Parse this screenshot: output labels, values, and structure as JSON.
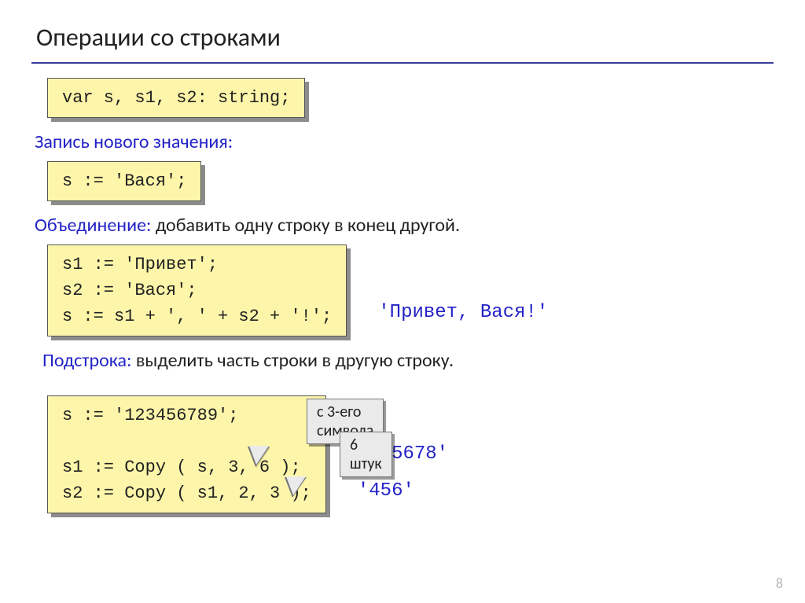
{
  "title": "Операции со строками",
  "code": {
    "declaration": "var s, s1, s2: string;",
    "assign_label_blue": "Запись нового значения:",
    "assign_code": "s := 'Вася';",
    "concat_label_blue": "Объединение:",
    "concat_label_rest": " добавить одну строку в конец другой.",
    "concat_code": "s1 := 'Привет';\ns2 := 'Вася';\ns := s1 + ', ' + s2 + '!';",
    "concat_result": "'Привет, Вася!'",
    "substr_label_blue": "Подстрока:",
    "substr_label_rest": " выделить часть строки в другую строку.",
    "substr_code": "s := '123456789';\n\ns1 := Copy ( s, 3, 6 );\ns2 := Copy ( s1, 2, 3 );",
    "callout1": "с 3-его символа",
    "callout2": "6 штук",
    "substr_result1": "'345678'",
    "substr_result2": "'456'"
  },
  "page_number": "8"
}
